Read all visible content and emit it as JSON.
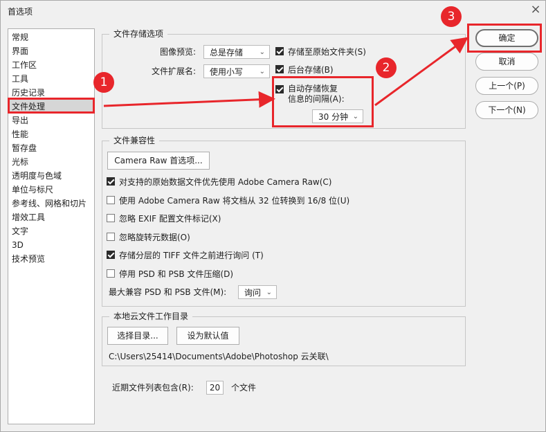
{
  "window": {
    "title": "首选项",
    "close_icon": "×"
  },
  "sidebar": {
    "items": [
      "常规",
      "界面",
      "工作区",
      "工具",
      "历史记录",
      "文件处理",
      "导出",
      "性能",
      "暂存盘",
      "光标",
      "透明度与色域",
      "单位与标尺",
      "参考线、网格和切片",
      "增效工具",
      "文字",
      "3D",
      "技术预览"
    ],
    "active_index": 5
  },
  "file_save": {
    "title": "文件存储选项",
    "image_preview_label": "图像预览:",
    "image_preview_value": "总是存储",
    "extension_label": "文件扩展名:",
    "extension_value": "使用小写",
    "save_to_original": {
      "label": "存储至原始文件夹(S)",
      "checked": true
    },
    "background_save": {
      "label": "后台存储(B)",
      "checked": true
    },
    "auto_recover": {
      "label_line1": "自动存储恢复",
      "label_line2": "信息的间隔(A):",
      "checked": true
    },
    "interval_value": "30 分钟"
  },
  "compat": {
    "title": "文件兼容性",
    "camera_raw_button": "Camera Raw 首选项...",
    "options": [
      {
        "label": "对支持的原始数据文件优先使用 Adobe Camera Raw(C)",
        "checked": true
      },
      {
        "label": "使用 Adobe Camera Raw 将文档从 32 位转换到 16/8 位(U)",
        "checked": false
      },
      {
        "label": "忽略 EXIF 配置文件标记(X)",
        "checked": false
      },
      {
        "label": "忽略旋转元数据(O)",
        "checked": false
      },
      {
        "label": "存储分层的 TIFF 文件之前进行询问 (T)",
        "checked": true
      },
      {
        "label": "停用 PSD 和 PSB 文件压缩(D)",
        "checked": false
      }
    ],
    "max_compat_label": "最大兼容 PSD 和 PSB 文件(M):",
    "max_compat_value": "询问"
  },
  "cloud": {
    "title": "本地云文件工作目录",
    "choose_button": "选择目录...",
    "default_button": "设为默认值",
    "path": "C:\\Users\\25414\\Documents\\Adobe\\Photoshop 云关联\\"
  },
  "recent": {
    "label": "近期文件列表包含(R):",
    "value": "20",
    "suffix": "个文件"
  },
  "buttons": {
    "ok": "确定",
    "cancel": "取消",
    "prev": "上一个(P)",
    "next": "下一个(N)"
  },
  "annotations": {
    "color": "#e8262b",
    "n1": "1",
    "n2": "2",
    "n3": "3"
  }
}
